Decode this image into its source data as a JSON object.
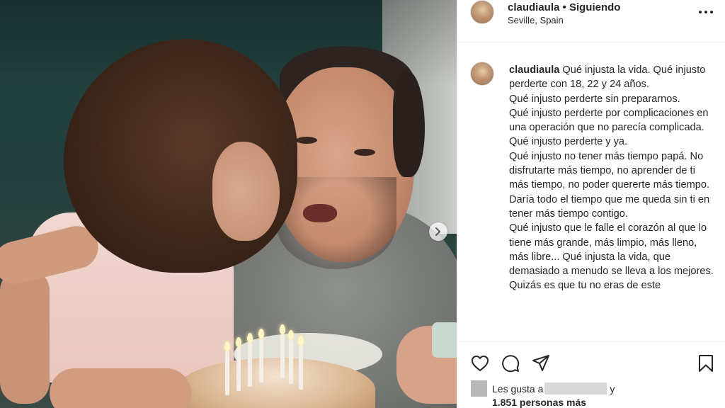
{
  "post": {
    "username": "claudiaula",
    "separator": "•",
    "follow_status": "Siguiendo",
    "location": "Seville, Spain"
  },
  "caption": {
    "username": "claudiaula",
    "lines": [
      "Qué injusta la vida. Qué injusto perderte con 18, 22 y 24 años.",
      "Qué injusto perderte sin prepararnos.",
      "Qué injusto perderte por complicaciones en una operación que no parecía complicada. Qué injusto perderte y ya.",
      "Qué injusto no tener más tiempo papá. No disfrutarte más tiempo, no aprender de ti más tiempo, no poder quererte más tiempo. Daría todo el tiempo que me queda sin ti en tener más tiempo contigo.",
      "Qué injusto que le falle el corazón al que lo tiene más grande, más limpio, más lleno, más libre... Qué injusta la vida, que demasiado a menudo se lleva a los mejores.",
      "Quizás es que tu no eras de este"
    ]
  },
  "likes": {
    "prefix": "Les gusta a",
    "suffix": "y",
    "count": "1.851 personas más"
  },
  "icons": {
    "more": "more-icon",
    "heart": "heart-icon",
    "comment": "comment-icon",
    "share": "share-icon",
    "save": "bookmark-icon",
    "next": "chevron-right-icon"
  },
  "colors": {
    "text": "#262626",
    "border": "#efefef",
    "background": "#ffffff"
  }
}
